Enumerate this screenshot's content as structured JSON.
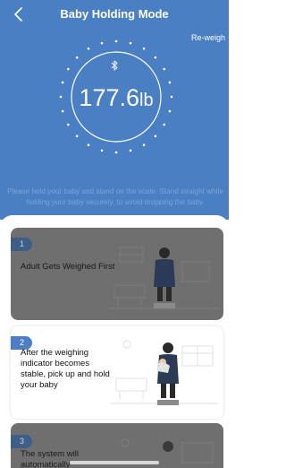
{
  "header": {
    "title": "Baby Holding Mode",
    "reweigh_label": "Re-weigh",
    "back_icon": "chevron-left-icon",
    "background": "#4a7fc4"
  },
  "scale": {
    "weight_value": "177.6",
    "weight_unit": "lb",
    "bluetooth_icon": "bluetooth-icon"
  },
  "instruction": "Please hold your baby and stand on the scale. Stand straight while holding your baby securely, to avoid dropping the baby.",
  "steps": [
    {
      "number": "1",
      "text": "Adult Gets Weighed First",
      "state": "inactive"
    },
    {
      "number": "2",
      "text": "After the weighing indicator becomes stable, pick up and hold your baby",
      "state": "active"
    },
    {
      "number": "3",
      "text": "The system will automatically",
      "state": "inactive"
    }
  ],
  "colors": {
    "accent": "#4a7fc4",
    "inactive_card": "#6f6f6f",
    "active_card": "#ffffff"
  }
}
